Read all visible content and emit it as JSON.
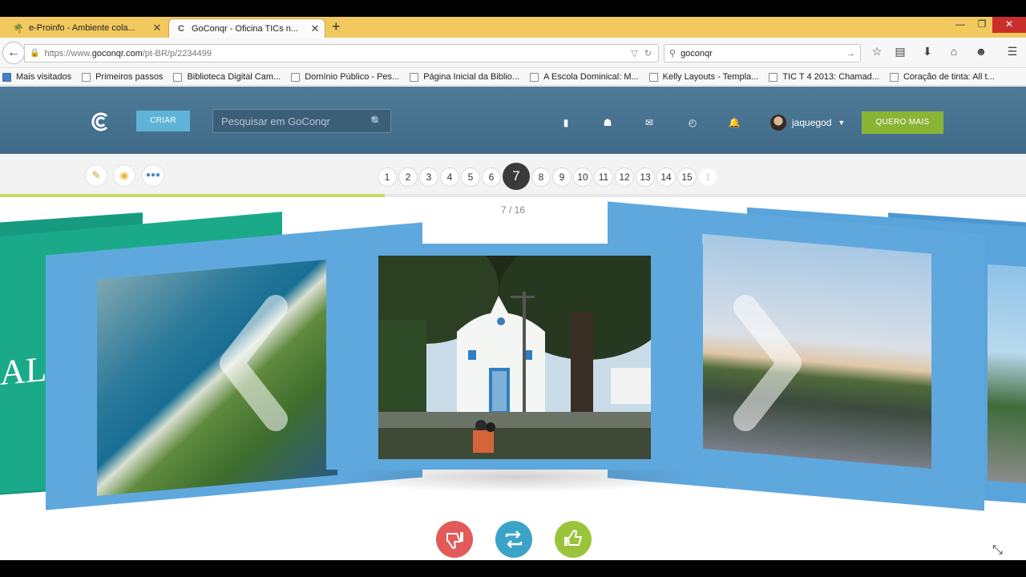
{
  "browser": {
    "tabs": [
      {
        "label": "e-Proinfo - Ambiente cola...",
        "icon": "palm-icon"
      },
      {
        "label": "GoConqr - Oficina TICs n...",
        "icon": "goconqr-icon"
      }
    ],
    "url_gray": "https://www.",
    "url_host": "goconqr.com",
    "url_path": "/pt-BR/p/2234499",
    "search_value": "goconqr",
    "bookmarks": [
      "Mais visitados",
      "Primeiros passos",
      "Biblioteca Digital Cam...",
      "Domínio Público - Pes...",
      "Página Inicial da Biblio...",
      "A Escola Dominical: M...",
      "Kelly Layouts - Templa...",
      "TIC T 4 2013: Chamad...",
      "Coração de tinta: All t..."
    ]
  },
  "site": {
    "create_label": "CRIAR",
    "search_placeholder": "Pesquisar em GoConqr",
    "username": "jaquegod",
    "upgrade_label": "QUERO MAIS"
  },
  "viewer": {
    "pages": [
      "1",
      "2",
      "3",
      "4",
      "5",
      "6",
      "7",
      "8",
      "9",
      "10",
      "11",
      "12",
      "13",
      "14",
      "15",
      "1"
    ],
    "current_page": 7,
    "total_pages": 16,
    "counter": "7 / 16",
    "progress": 0.375,
    "left_slide_text": "AL"
  },
  "colors": {
    "accent_blue": "#5fa8de",
    "teal": "#1aa88a",
    "header": "#4a7594",
    "upgrade_green": "#8ab434",
    "dislike": "#e35a5a",
    "share": "#3ba3c8",
    "like": "#9bc43b"
  }
}
